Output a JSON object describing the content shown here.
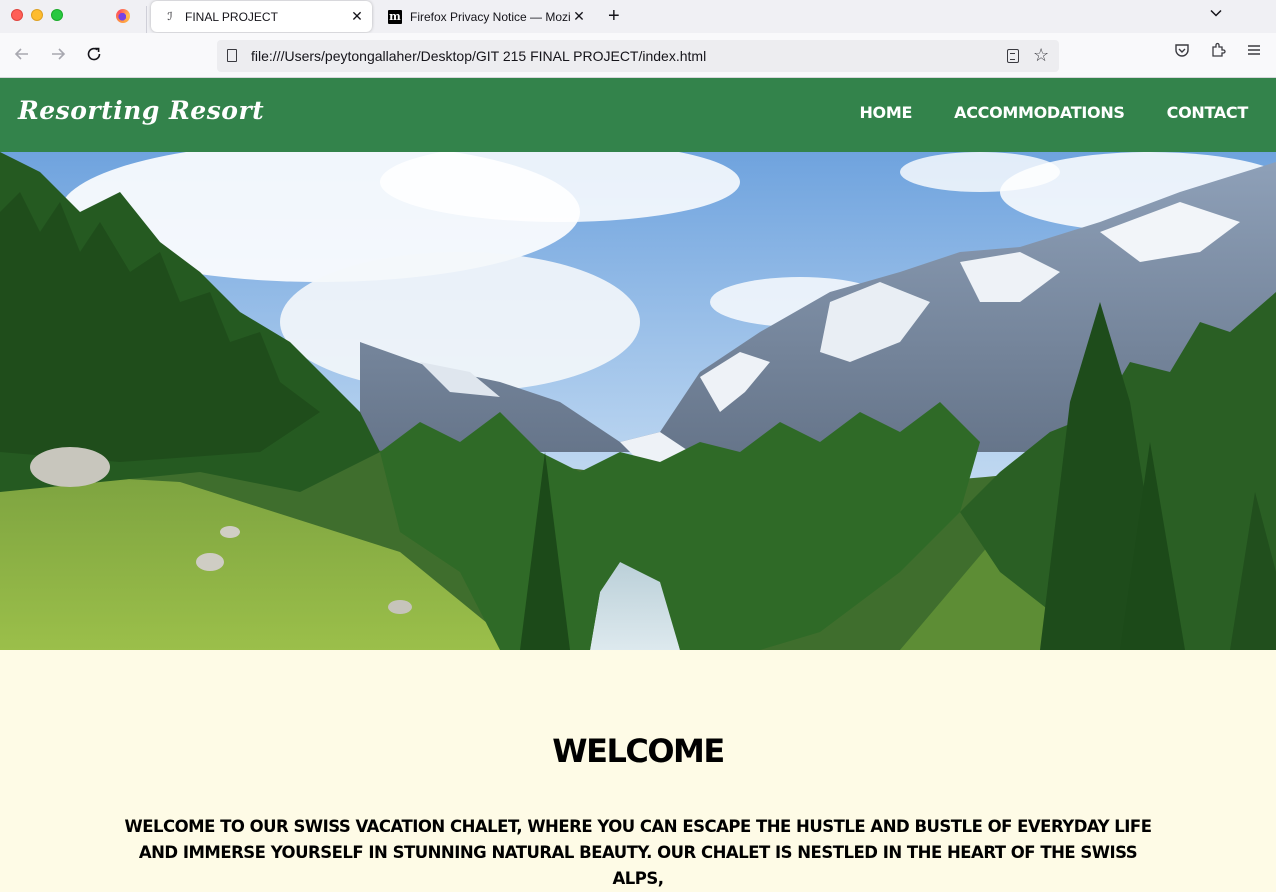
{
  "browser": {
    "tabs": [
      {
        "title": "FINAL PROJECT",
        "active": true,
        "favicon": "document-icon"
      },
      {
        "title": "Firefox Privacy Notice — Mozilla",
        "active": false,
        "favicon": "mozilla-m-icon"
      }
    ],
    "url": "file:///Users/peytongallaher/Desktop/GIT 215 FINAL PROJECT/index.html"
  },
  "site": {
    "logo": "Resorting Resort",
    "nav": [
      "HOME",
      "ACCOMMODATIONS",
      "CONTACT"
    ],
    "brand_color": "#33834b",
    "background_color": "#fefbe6"
  },
  "hero": {
    "image": "mountain-valley-photo"
  },
  "welcome": {
    "heading": "WELCOME",
    "body": "WELCOME TO OUR SWISS VACATION CHALET, WHERE YOU CAN ESCAPE THE HUSTLE AND BUSTLE OF EVERYDAY LIFE AND IMMERSE YOURSELF IN STUNNING NATURAL BEAUTY. OUR CHALET IS NESTLED IN THE HEART OF THE SWISS ALPS,"
  }
}
